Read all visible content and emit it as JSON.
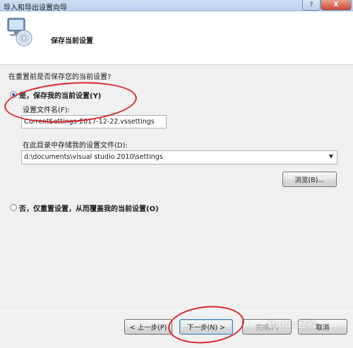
{
  "window": {
    "title": "导入和导出设置向导",
    "help_label": "?",
    "close_label": "X"
  },
  "header": {
    "title": "保存当前设置",
    "icon": "computer-disc-icon"
  },
  "form": {
    "question": "在重置前是否保存您的当前设置?",
    "yes_option": "是，保存我的当前设置(Y)",
    "filename_label": "设置文件名(F):",
    "filename_value": "CurrentSettings-2017-12-22.vssettings",
    "dir_label": "在此目录中存储我的设置文件(D):",
    "dir_value": "d:\\documents\\visual studio 2010\\settings",
    "browse_label": "浏览(B)...",
    "no_option": "否，仅重置设置，从而覆盖我的当前设置(O)",
    "selected": "yes"
  },
  "footer": {
    "prev_label": "< 上一步(P)",
    "next_label": "下一步(N) >",
    "finish_label": "完成(F)",
    "cancel_label": "取消"
  },
  "overlay": {
    "annotation_color": "#d9252c",
    "watermark": "Baidu经验"
  }
}
